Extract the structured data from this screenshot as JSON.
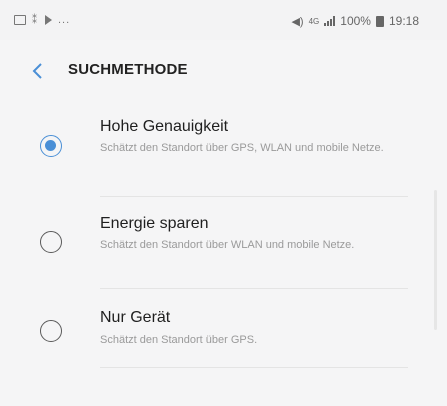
{
  "status_bar": {
    "icons_left": [
      "image-icon",
      "notification-icon",
      "play-icon",
      "more-icon"
    ],
    "overflow_text": "...",
    "mute_icon": "mute-icon",
    "network_type": "4G",
    "battery": "100%",
    "time": "19:18"
  },
  "header": {
    "back_icon": "chevron-left-icon",
    "title": "SUCHMETHODE"
  },
  "accent_color": "#4a8fd6",
  "options": [
    {
      "label": "Hohe Genauigkeit",
      "description": "Schätzt den Standort über GPS, WLAN und mobile Netze.",
      "selected": true
    },
    {
      "label": "Energie sparen",
      "description": "Schätzt den Standort über WLAN und mobile Netze.",
      "selected": false
    },
    {
      "label": "Nur Gerät",
      "description": "Schätzt den Standort über GPS.",
      "selected": false
    }
  ]
}
